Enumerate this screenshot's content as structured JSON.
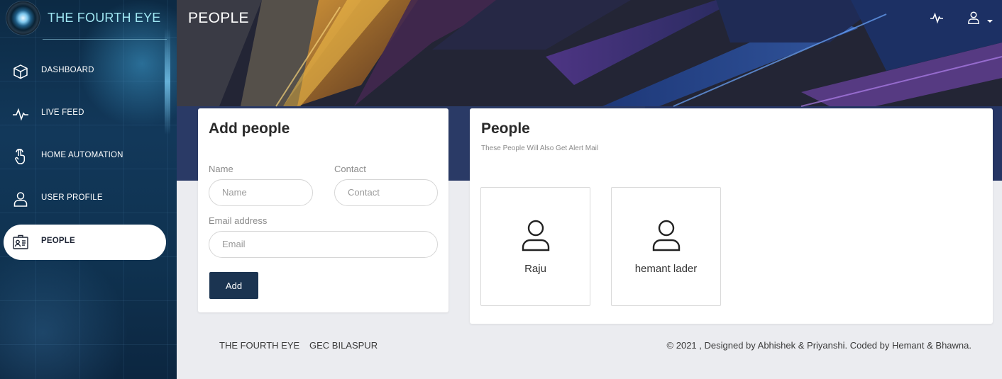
{
  "brand": {
    "name": "THE FOURTH EYE"
  },
  "page": {
    "title": "PEOPLE"
  },
  "sidebar": {
    "items": [
      {
        "label": "DASHBOARD",
        "icon": "cube-icon"
      },
      {
        "label": "LIVE FEED",
        "icon": "pulse-icon"
      },
      {
        "label": "HOME AUTOMATION",
        "icon": "touch-icon"
      },
      {
        "label": "USER PROFILE",
        "icon": "user-icon"
      },
      {
        "label": "PEOPLE",
        "icon": "id-badge-icon",
        "active": true
      }
    ]
  },
  "topbar": {
    "icons": [
      "pulse-icon",
      "user-icon",
      "caret-down-icon"
    ]
  },
  "add_people": {
    "title": "Add people",
    "name_label": "Name",
    "name_placeholder": "Name",
    "contact_label": "Contact",
    "contact_placeholder": "Contact",
    "email_label": "Email address",
    "email_placeholder": "Email",
    "add_label": "Add"
  },
  "people": {
    "title": "People",
    "subtitle": "These People Will Also Get Alert Mail",
    "list": [
      {
        "name": "Raju"
      },
      {
        "name": "hemant lader"
      }
    ]
  },
  "footer": {
    "links": [
      "THE FOURTH EYE",
      "GEC BILASPUR"
    ],
    "credit": "© 2021 , Designed by Abhishek & Priyanshi. Coded by Hemant & Bhawna."
  },
  "colors": {
    "sidebar": "#12385a",
    "brand_text": "#9fe6f2",
    "button": "#1b3451",
    "page_bg": "#ebecf0"
  }
}
